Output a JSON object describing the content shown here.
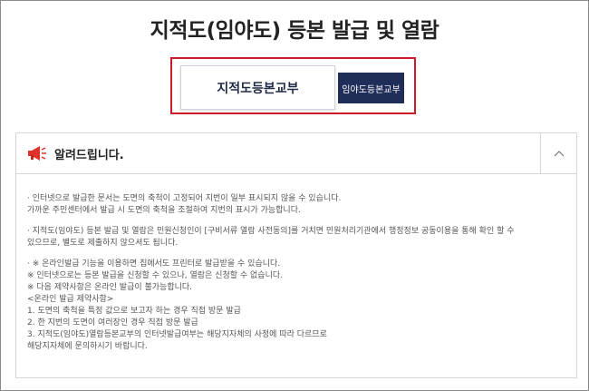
{
  "page": {
    "title": "지적도(임야도) 등본 발급 및 열람"
  },
  "tabs": {
    "main_label": "지적도등본교부",
    "sub_label": "임야도등본교부"
  },
  "notice": {
    "title": "알려드립니다.",
    "icon": "megaphone-icon",
    "toggle_icon": "chevron-up-icon",
    "paragraphs": [
      {
        "lines": [
          "· 인터넷으로 발급한 문서는 도면의 축척이 고정되어 지번이 일부 표시되지 않을 수 있습니다.",
          "  가까운 주민센터에서 발급 시 도면의 축척을 조절하여 지번의 표시가 가능합니다."
        ]
      },
      {
        "lines": [
          "· 지적도(임야도) 등본 발급 및 열람은 민원신청인이 [구비서류 열람 사전동의]를 거치면 민원처리기관에서 행정정보 공동이용을 통해 확인 할 수",
          "  있으므로, 별도로 제출하지 않으셔도 됩니다."
        ]
      },
      {
        "lines": [
          "· ※ 온라인발급 기능을 이용하면 집에서도 프린터로 발급받을 수 있습니다.",
          "  ※ 인터넷으로는 등본 발급을 신청할 수 있으나, 열람은 신청할 수 없습니다.",
          "  ※ 다음 제약사항은 온라인 발급이 불가능합니다.",
          "  <온라인 발급 제약사항>",
          "  1. 도면의 축척을 특정 값으로 보고자 하는 경우 직접 방문 발급",
          "  2. 한 지번의 도면이 여러장인 경우 직접 방문 발급",
          "  3. 지적도(임야도)열람등본교부의 인터넷발급여부는 해당지자체의 사정에 따라 다르므로",
          "  해당지자체에 문의하시기 바랍니다."
        ]
      }
    ]
  },
  "colors": {
    "highlight_border": "#d0192a",
    "sub_tab_bg": "#1f2e59",
    "icon_red": "#e0312b"
  }
}
